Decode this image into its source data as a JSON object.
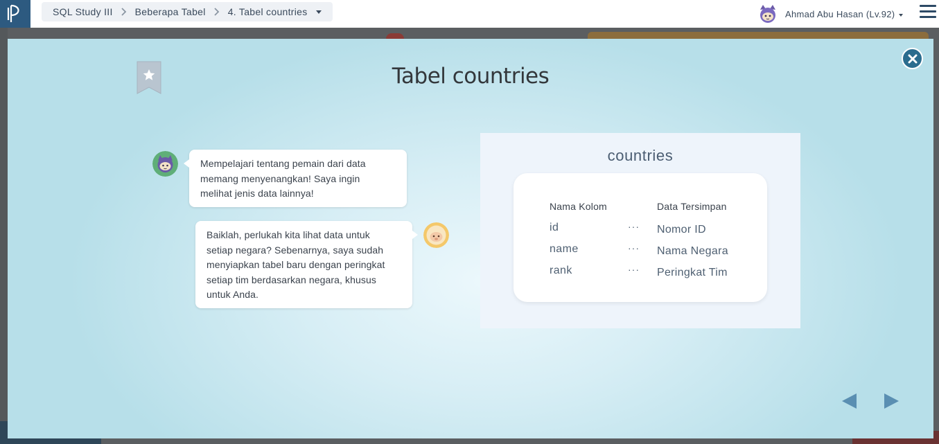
{
  "header": {
    "breadcrumb": [
      {
        "label": "SQL Study III"
      },
      {
        "label": "Beberapa Tabel"
      },
      {
        "label": "4. Tabel countries"
      }
    ],
    "user_name": "Ahmad Abu Hasan (Lv.92)",
    "logo_icon": "progate-logo-icon",
    "menu_icon": "hamburger-menu-icon"
  },
  "modal": {
    "title": "Tabel countries",
    "bookmark_icon": "bookmark-star-icon",
    "close_icon": "close-icon",
    "chat": [
      {
        "speaker": "ninja-cat",
        "side": "left",
        "lines": [
          "Mempelajari tentang pemain dari data",
          "memang menyenangkan! Saya ingin",
          "melihat jenis data lainnya!"
        ]
      },
      {
        "speaker": "sheep-mentor",
        "side": "right",
        "lines": [
          "Baiklah, perlukah kita lihat data untuk",
          "setiap negara? Sebenarnya, saya sudah",
          "menyiapkan tabel baru dengan peringkat",
          "setiap tim berdasarkan negara, khusus",
          "untuk Anda."
        ]
      }
    ],
    "table": {
      "title": "countries",
      "headers": {
        "column": "Nama Kolom",
        "data": "Data Tersimpan"
      },
      "rows": [
        {
          "column": "id",
          "dots": "···",
          "data": "Nomor ID"
        },
        {
          "column": "name",
          "dots": "···",
          "data": "Nama Negara"
        },
        {
          "column": "rank",
          "dots": "···",
          "data": "Peringkat Tim"
        }
      ]
    },
    "nav": {
      "prev_icon": "triangle-left-icon",
      "next_icon": "triangle-right-icon"
    }
  },
  "colors": {
    "brand_dark": "#2d5a80",
    "close_button": "#2a6c8e",
    "nav_arrow": "#5a8fb2"
  }
}
